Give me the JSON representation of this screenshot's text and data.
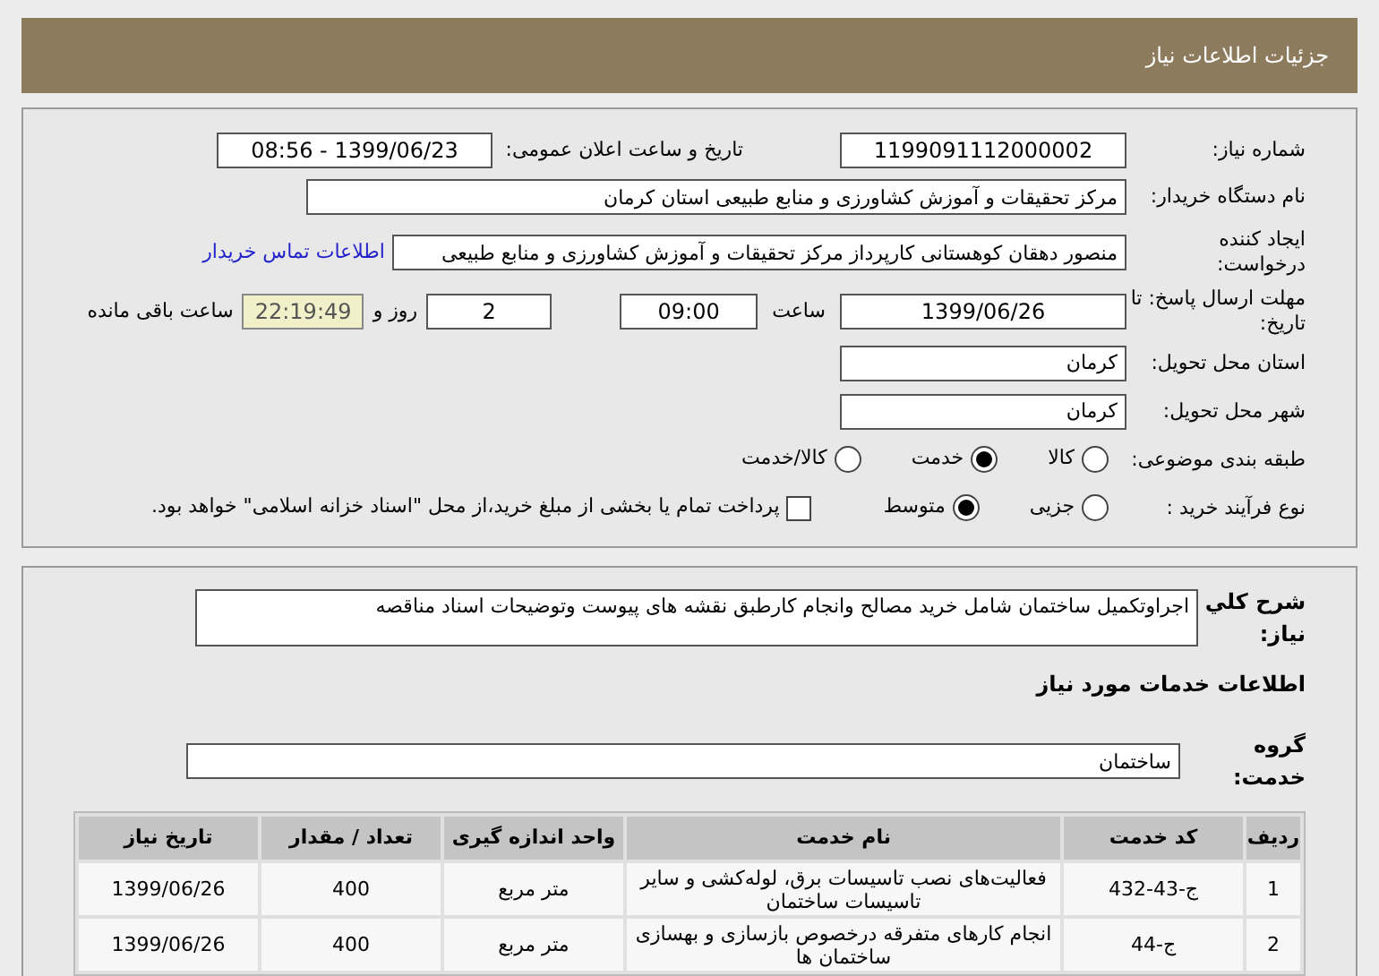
{
  "header": {
    "title": "جزئیات اطلاعات نیاز"
  },
  "need_number": {
    "label": "شماره نیاز:",
    "value": "1199091112000002"
  },
  "announce": {
    "label": "تاریخ و ساعت اعلان عمومی:",
    "value": "1399/06/23 - 08:56"
  },
  "buyer": {
    "label": "نام دستگاه خریدار:",
    "value": "مرکز تحقیقات و آموزش کشاورزی و منابع طبیعی استان کرمان"
  },
  "requester": {
    "label": "ایجاد کننده درخواست:",
    "value": "منصور دهقان کوهستانی کارپرداز مرکز تحقیقات و آموزش کشاورزی و منابع طبیعی",
    "contact_link": "اطلاعات تماس خریدار"
  },
  "deadline": {
    "label": "مهلت ارسال پاسخ: تا تاریخ:",
    "date": "1399/06/26",
    "time_label": "ساعت",
    "time": "09:00",
    "days": "2",
    "days_label": "روز و",
    "remaining": "22:19:49",
    "remaining_label": "ساعت باقی مانده"
  },
  "province": {
    "label": "استان محل تحویل:",
    "value": "کرمان"
  },
  "city": {
    "label": "شهر محل تحویل:",
    "value": "کرمان"
  },
  "category": {
    "label": "طبقه بندی موضوعی:",
    "options": [
      {
        "label": "کالا",
        "selected": false
      },
      {
        "label": "خدمت",
        "selected": true
      },
      {
        "label": "کالا/خدمت",
        "selected": false
      }
    ]
  },
  "process": {
    "label": "نوع فرآیند خرید :",
    "options": [
      {
        "label": "جزیی",
        "selected": false
      },
      {
        "label": "متوسط",
        "selected": true
      }
    ],
    "payment": {
      "label": "پرداخت تمام یا بخشی از مبلغ خرید،از محل \"اسناد خزانه اسلامی\" خواهد بود.",
      "checked": false
    }
  },
  "description": {
    "label": "شرح کلي نياز:",
    "value": "اجراوتکمیل ساختمان شامل خرید مصالح وانجام کارطبق نقشه های پیوست وتوضیحات اسناد مناقصه"
  },
  "services_heading": "اطلاعات خدمات مورد نیاز",
  "service_group": {
    "label": "گروه خدمت:",
    "value": "ساختمان"
  },
  "table": {
    "columns": [
      "ردیف",
      "کد خدمت",
      "نام خدمت",
      "واحد اندازه گیری",
      "تعداد / مقدار",
      "تاریخ نیاز"
    ],
    "rows": [
      [
        "1",
        "ج-43-432",
        "فعالیت‌های نصب تاسیسات برق، لوله‌کشی و سایر تاسیسات ساختمان",
        "متر مربع",
        "400",
        "1399/06/26"
      ],
      [
        "2",
        "ج-44",
        "انجام کارهای متفرقه درخصوص بازسازی و بهسازی ساختمان ها",
        "متر مربع",
        "400",
        "1399/06/26"
      ]
    ]
  }
}
